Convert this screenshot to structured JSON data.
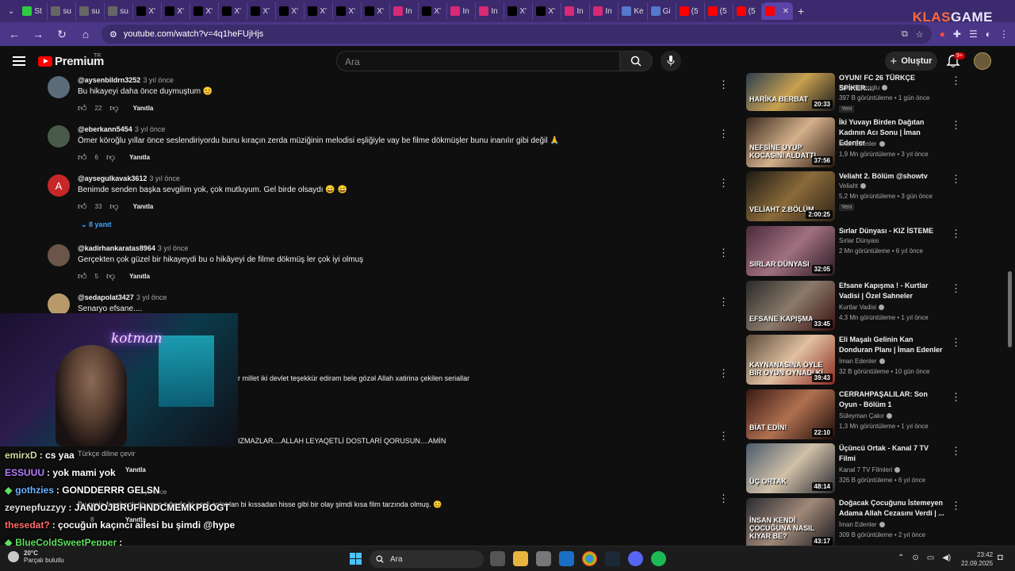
{
  "browser": {
    "tabs": [
      {
        "icon": "site-green-icon",
        "label": "St",
        "color": "#2ecc40"
      },
      {
        "icon": "site-mid-icon",
        "label": "su",
        "color": "#666"
      },
      {
        "icon": "site-mid-icon",
        "label": "su",
        "color": "#666"
      },
      {
        "icon": "site-mid-icon",
        "label": "su",
        "color": "#666"
      },
      {
        "icon": "x-icon",
        "label": "X'",
        "color": "#000"
      },
      {
        "icon": "x-icon",
        "label": "X'",
        "color": "#000"
      },
      {
        "icon": "x-icon",
        "label": "X'",
        "color": "#000"
      },
      {
        "icon": "x-icon",
        "label": "X'",
        "color": "#000"
      },
      {
        "icon": "x-icon",
        "label": "X'",
        "color": "#000"
      },
      {
        "icon": "x-icon",
        "label": "X'",
        "color": "#000"
      },
      {
        "icon": "x-icon",
        "label": "X'",
        "color": "#000"
      },
      {
        "icon": "x-icon",
        "label": "X'",
        "color": "#000"
      },
      {
        "icon": "x-icon",
        "label": "X'",
        "color": "#000"
      },
      {
        "icon": "instagram-icon",
        "label": "In",
        "color": "#d62976"
      },
      {
        "icon": "x-icon",
        "label": "X'",
        "color": "#000"
      },
      {
        "icon": "instagram-icon",
        "label": "In",
        "color": "#d62976"
      },
      {
        "icon": "instagram-icon",
        "label": "In",
        "color": "#d62976"
      },
      {
        "icon": "x-icon",
        "label": "X'",
        "color": "#000"
      },
      {
        "icon": "x-icon",
        "label": "X'",
        "color": "#000"
      },
      {
        "icon": "instagram-icon",
        "label": "In",
        "color": "#d62976"
      },
      {
        "icon": "instagram-icon",
        "label": "In",
        "color": "#d62976"
      },
      {
        "icon": "document-icon",
        "label": "Ke",
        "color": "#5577cc"
      },
      {
        "icon": "grid-icon",
        "label": "Gi",
        "color": "#5577cc"
      },
      {
        "icon": "youtube-icon",
        "label": "(5",
        "color": "#ff0000"
      },
      {
        "icon": "youtube-icon",
        "label": "(5",
        "color": "#ff0000"
      },
      {
        "icon": "youtube-icon",
        "label": "(5",
        "color": "#ff0000"
      },
      {
        "icon": "youtube-icon",
        "label": "",
        "color": "#ff0000",
        "active": true
      }
    ],
    "new_tab": "+",
    "brand_left": "KLAS",
    "brand_right": "GAME",
    "url": "youtube.com/watch?v=4q1heFUjHjs"
  },
  "youtube": {
    "logo_text": "Premium",
    "region": "TR",
    "search_placeholder": "Ara",
    "create_label": "Oluştur",
    "notif_count": "9+"
  },
  "comments": [
    {
      "user": "@aysenbildrn3252",
      "time": "3 yıl önce",
      "text": "Bu hikayeyi daha önce duymuştum 😊",
      "likes": "22",
      "reply": "Yanıtla",
      "avatar_color": "#5c6b7a"
    },
    {
      "user": "@eberkann5454",
      "time": "3 yıl önce",
      "text": "Ömer köroğlu yıllar önce seslendiriyordu bunu kıraçın zerda müziğinin melodisi eşliğiyle vay be filme dökmüşler bunu inanılır gibi değil 🙏",
      "likes": "6",
      "reply": "Yanıtla",
      "avatar_color": "#4a5a4a"
    },
    {
      "user": "@aysegulkavak3612",
      "time": "3 yıl önce",
      "text": "Benimde senden başka sevgilim yok, çok mutluyum. Gel birde olsaydı 😄 😄",
      "likes": "33",
      "reply": "Yanıtla",
      "avatar_color": "#c62828",
      "avatar_letter": "A"
    },
    {
      "user": "@kadirhankaratas8964",
      "time": "3 yıl önce",
      "text": "Gerçekten çok güzel bir hikayeydi bu o hikâyeyi de filme dökmüş ler çok iyi olmuş",
      "likes": "5",
      "reply": "Yanıtla",
      "avatar_color": "#6b5548"
    },
    {
      "user": "@sedapolat3427",
      "time": "3 yıl önce",
      "text": "Senaryo efsane....",
      "avatar_color": "#b89a6a"
    }
  ],
  "replies_toggle": "8 yanıt",
  "overlay_texts": {
    "partial1": "r millet iki devlet teşekkür edirəm bele gözəl Allah xatirinə çekilen seriallar",
    "partial2": "IZMAZLAR....ALLAH LEYAQETLİ DOSTLARİ QORUSUN....AMİN",
    "translate": "Türkçe diline çevir",
    "reply_a": "Yanıtla",
    "time_b": "3 yıl önce",
    "partial3": "Bu proje facebook da veya tubede bi sesli anlatılan bi kıssadan hisse gibi bir olay şimdi kısa film tarzında olmuş. 😊",
    "reply_b": "Yanıtla",
    "likes_b": "8"
  },
  "webcam": {
    "neon_sign": "kotman"
  },
  "chat": [
    {
      "user": "emirxD",
      "msg": ": cs yaa",
      "color": "#d8d8a0"
    },
    {
      "user": "ESSUUU",
      "msg": ": yok mami yok",
      "color": "#b57cff"
    },
    {
      "user": "gothzies",
      "msg": ": GONDDERRR GELSN",
      "color": "#6ab4ff",
      "badge": true
    },
    {
      "user": "zeynepfuzzyy",
      "msg": ": JANDOJBRUFHNDCMEMKPBOGT",
      "color": "#e0e0e0"
    },
    {
      "user": "thesedat?",
      "msg": ": çocuğun kaçıncı ailesi bu şimdi @hype",
      "color": "#ff6b6b"
    },
    {
      "user": "BlueColdSweetPepper",
      "msg": ":",
      "color": "#5fe05f",
      "badge": true
    }
  ],
  "videos": [
    {
      "title": "OYUN! FC 26 TÜRKÇE SPİKER...",
      "channel": "Enis Kirazoglu",
      "verified": true,
      "meta": "397 B görüntüleme • 1 gün önce",
      "duration": "20:33",
      "new": "Yeni",
      "caption": "HARİKA BERBAT",
      "thumb": "linear-gradient(135deg,#2c3e50,#c8a050,#1b1b1b)"
    },
    {
      "title": "İki Yuvayı Birden Dağıtan Kadının Acı Sonu | İman Edenler",
      "channel": "İman Edenler",
      "verified": true,
      "meta": "1,9 Mn görüntüleme • 3 yıl önce",
      "duration": "37:56",
      "caption": "NEFSİNE UYUP KOCASINI ALDATTI",
      "thumb": "linear-gradient(135deg,#3a2a1e,#d4b08c,#2a1a10)"
    },
    {
      "title": "Veliaht 2. Bölüm @showtv",
      "channel": "Veliaht",
      "verified": true,
      "meta": "5,2 Mn görüntüleme • 3 gün önce",
      "duration": "2:00:25",
      "new": "Yeni",
      "caption": "VELİAHT 2.BÖLÜM",
      "thumb": "linear-gradient(135deg,#1d1a14,#8a6a3a,#2e2418)"
    },
    {
      "title": "Sırlar Dünyası - KIZ İSTEME",
      "channel": "Sırlar Dünyası",
      "verified": false,
      "meta": "2 Mn görüntüleme • 6 yıl önce",
      "duration": "32:05",
      "caption": "SIRLAR DÜNYASI",
      "thumb": "linear-gradient(135deg,#4a2a3a,#a07080,#2a1a22)"
    },
    {
      "title": "Efsane Kapışma ! - Kurtlar Vadisi | Özel Sahneler",
      "channel": "Kurtlar Vadisi",
      "verified": true,
      "meta": "4,3 Mn görüntüleme • 1 yıl önce",
      "duration": "33:45",
      "caption": "EFSANE KAPIŞMA",
      "thumb": "linear-gradient(135deg,#2a2a2a,#8a7a6a,#3a1010)"
    },
    {
      "title": "Eli Maşalı Gelinin Kan Donduran Planı |  İman Edenler",
      "channel": "İman Edenler",
      "verified": true,
      "meta": "32 B görüntüleme • 10 gün önce",
      "duration": "39:43",
      "caption": "KAYNANASINA ÖYLE BİR OYUN OYNADI Kİ",
      "thumb": "linear-gradient(135deg,#5a4a3a,#e0c0a0,#8a2a20)"
    },
    {
      "title": "CERRAHPAŞALILAR: Son Oyun - Bölüm 1",
      "channel": "Süleyman Çakır",
      "verified": true,
      "meta": "1,3 Mn görüntüleme • 1 yıl önce",
      "duration": "22:10",
      "caption": "BİAT EDİN!",
      "thumb": "linear-gradient(135deg,#3a1a14,#b07050,#1a0a08)"
    },
    {
      "title": "Üçüncü Ortak - Kanal 7 TV Filmi",
      "channel": "Kanal 7 TV Filmleri",
      "verified": true,
      "meta": "326 B görüntüleme • 6 yıl önce",
      "duration": "48:14",
      "caption": "ÜÇ ORTAK",
      "thumb": "linear-gradient(135deg,#4a5a6a,#d0c0a8,#2a2a30)"
    },
    {
      "title": "Doğacak Çocuğunu İstemeyen Adama Allah Cezasını Verdi | ...",
      "channel": "İman Edenler",
      "verified": true,
      "meta": "309 B görüntüleme • 2 yıl önce",
      "duration": "43:17",
      "caption": "İNSAN KENDİ ÇOCUĞUNA NASIL KIYAR BE?",
      "thumb": "linear-gradient(135deg,#2a2a30,#a08878,#14141a)"
    }
  ],
  "taskbar": {
    "temp": "20°C",
    "weather": "Parçalı bulutlu",
    "search": "Ara",
    "time": "23:42",
    "date": "22.09.2025"
  }
}
